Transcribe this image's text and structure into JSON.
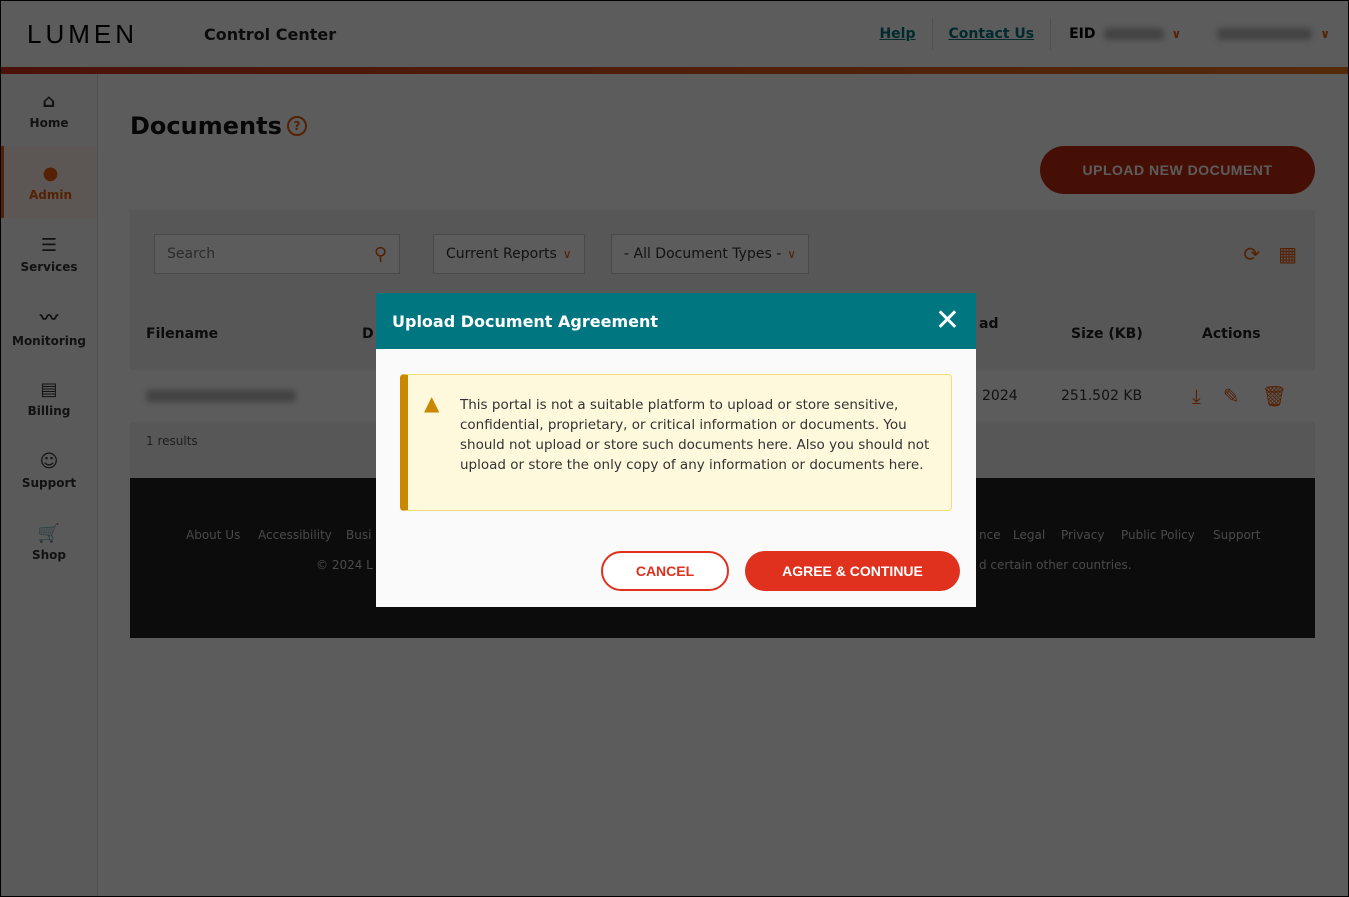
{
  "header": {
    "logo": "LUMEN",
    "app_title": "Control Center",
    "help": "Help",
    "contact": "Contact Us",
    "eid_label": "EID"
  },
  "sidebar": {
    "items": [
      {
        "label": "Home",
        "icon": "home-icon"
      },
      {
        "label": "Admin",
        "icon": "user-icon",
        "active": true
      },
      {
        "label": "Services",
        "icon": "list-icon"
      },
      {
        "label": "Monitoring",
        "icon": "pulse-icon"
      },
      {
        "label": "Billing",
        "icon": "invoice-icon"
      },
      {
        "label": "Support",
        "icon": "support-icon"
      },
      {
        "label": "Shop",
        "icon": "cart-icon"
      }
    ]
  },
  "page": {
    "title": "Documents",
    "upload_label": "UPLOAD NEW DOCUMENT"
  },
  "filters": {
    "search_placeholder": "Search",
    "reports": "Current Reports",
    "types": "- All Document Types -"
  },
  "table": {
    "columns": [
      "Filename",
      "D",
      "ad",
      "Size (KB)",
      "Actions"
    ],
    "row": {
      "date": "2024",
      "size": "251.502 KB"
    },
    "results": "1 results"
  },
  "footer": {
    "links": [
      "About Us",
      "Accessibility",
      "Busi",
      "nce",
      "Legal",
      "Privacy",
      "Public Policy",
      "Support"
    ],
    "copyright_left": "© 2024 L",
    "copyright_right": "d certain other countries."
  },
  "modal": {
    "title": "Upload Document Agreement",
    "message": "This portal is not a suitable platform to upload or store sensitive, confidential, proprietary, or critical information or documents. You should not upload or store such documents here. Also you should not upload or store the only copy of any information or documents here.",
    "cancel": "CANCEL",
    "agree": "AGREE & CONTINUE"
  },
  "colors": {
    "accent": "#e85c0d",
    "teal": "#007680",
    "danger": "#e0301e"
  }
}
